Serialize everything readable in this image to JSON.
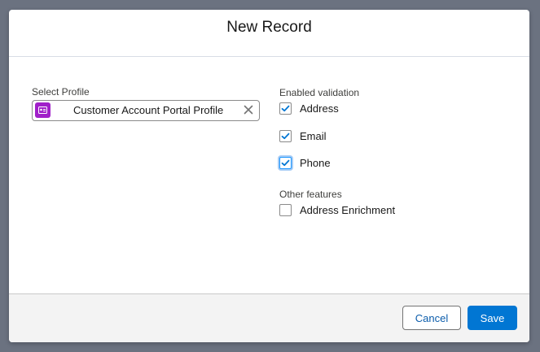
{
  "modal": {
    "title": "New Record"
  },
  "profile": {
    "label": "Select Profile",
    "value": "Customer Account Portal Profile",
    "icon": "profile-card-icon",
    "icon_color": "#a020c9"
  },
  "validation": {
    "label": "Enabled validation",
    "options": [
      {
        "label": "Address",
        "checked": true
      },
      {
        "label": "Email",
        "checked": true
      },
      {
        "label": "Phone",
        "checked": true
      }
    ]
  },
  "features": {
    "label": "Other features",
    "options": [
      {
        "label": "Address Enrichment",
        "checked": false
      }
    ]
  },
  "footer": {
    "cancel_label": "Cancel",
    "save_label": "Save"
  },
  "colors": {
    "brand": "#0176d3",
    "check": "#0176d3",
    "backdrop": "#6b7280"
  }
}
